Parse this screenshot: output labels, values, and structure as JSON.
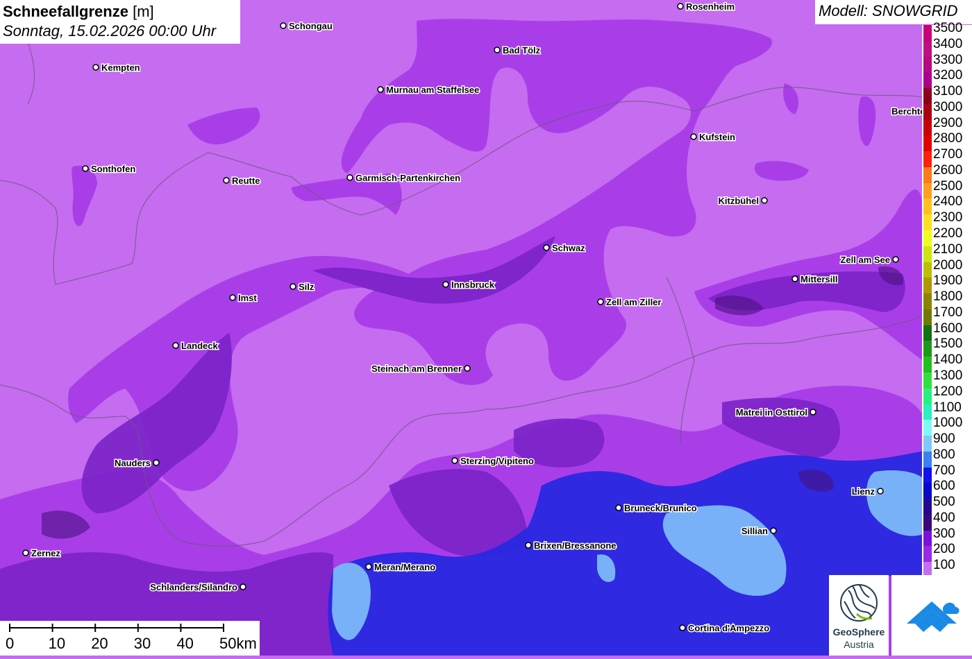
{
  "title": {
    "bold": "Schneefallgrenze",
    "unit": "[m]",
    "datetime": "Sonntag, 15.02.2026 00:00 Uhr"
  },
  "model": "Modell: SNOWGRID",
  "legend": [
    {
      "label": "3500",
      "color": "#c8007a"
    },
    {
      "label": "3400",
      "color": "#c0107f"
    },
    {
      "label": "3300",
      "color": "#b50a83"
    },
    {
      "label": "3200",
      "color": "#a8008c"
    },
    {
      "label": "3100",
      "color": "#8a0018"
    },
    {
      "label": "3000",
      "color": "#aa0010"
    },
    {
      "label": "2900",
      "color": "#c80008"
    },
    {
      "label": "2800",
      "color": "#e00000"
    },
    {
      "label": "2700",
      "color": "#ff2010"
    },
    {
      "label": "2600",
      "color": "#ff7a18"
    },
    {
      "label": "2500",
      "color": "#ff9e20"
    },
    {
      "label": "2400",
      "color": "#ffc020"
    },
    {
      "label": "2300",
      "color": "#ffe020"
    },
    {
      "label": "2200",
      "color": "#eeff20"
    },
    {
      "label": "2100",
      "color": "#cce610"
    },
    {
      "label": "2000",
      "color": "#bcc000"
    },
    {
      "label": "1900",
      "color": "#b09800"
    },
    {
      "label": "1800",
      "color": "#8c8400"
    },
    {
      "label": "1700",
      "color": "#6e7a00"
    },
    {
      "label": "1600",
      "color": "#127010"
    },
    {
      "label": "1500",
      "color": "#1c9a18"
    },
    {
      "label": "1400",
      "color": "#20c020"
    },
    {
      "label": "1300",
      "color": "#30e040"
    },
    {
      "label": "1200",
      "color": "#28f080"
    },
    {
      "label": "1100",
      "color": "#28f0c0"
    },
    {
      "label": "1000",
      "color": "#80f8f8"
    },
    {
      "label": "900",
      "color": "#80c8f8"
    },
    {
      "label": "800",
      "color": "#3a80f0"
    },
    {
      "label": "700",
      "color": "#1010f0"
    },
    {
      "label": "600",
      "color": "#0808c8"
    },
    {
      "label": "500",
      "color": "#200890"
    },
    {
      "label": "400",
      "color": "#3a0878"
    },
    {
      "label": "300",
      "color": "#7a10e0"
    },
    {
      "label": "200",
      "color": "#9a28e8"
    },
    {
      "label": "100",
      "color": "#c56cf0"
    }
  ],
  "cities": [
    {
      "name": "Rosenheim"
    },
    {
      "name": "Schongau"
    },
    {
      "name": "Bad Tölz"
    },
    {
      "name": "Kempten"
    },
    {
      "name": "Murnau am Staffelsee"
    },
    {
      "name": "Berchtesgaden"
    },
    {
      "name": "Kufstein"
    },
    {
      "name": "Sonthofen"
    },
    {
      "name": "Reutte"
    },
    {
      "name": "Garmisch-Partenkirchen"
    },
    {
      "name": "Kitzbühel"
    },
    {
      "name": "Schwaz"
    },
    {
      "name": "Zell am See"
    },
    {
      "name": "Mittersill"
    },
    {
      "name": "Innsbruck"
    },
    {
      "name": "Imst"
    },
    {
      "name": "Silz"
    },
    {
      "name": "Zell am Ziller"
    },
    {
      "name": "Landeck"
    },
    {
      "name": "Steinach am Brenner"
    },
    {
      "name": "Matrei in Osttirol"
    },
    {
      "name": "Nauders"
    },
    {
      "name": "Sterzing/Vipiteno"
    },
    {
      "name": "Lienz"
    },
    {
      "name": "Bruneck/Brunico"
    },
    {
      "name": "Sillian"
    },
    {
      "name": "Brixen/Bressanone"
    },
    {
      "name": "Zernez"
    },
    {
      "name": "Meran/Merano"
    },
    {
      "name": "Schlanders/Silandro"
    },
    {
      "name": "Cortina d'Ampezzo"
    }
  ],
  "scale": {
    "labels": [
      "0",
      "10",
      "20",
      "30",
      "40",
      "50km"
    ]
  },
  "logos": {
    "geosphere_line1": "GeoSphere",
    "geosphere_line2": "Austria"
  }
}
